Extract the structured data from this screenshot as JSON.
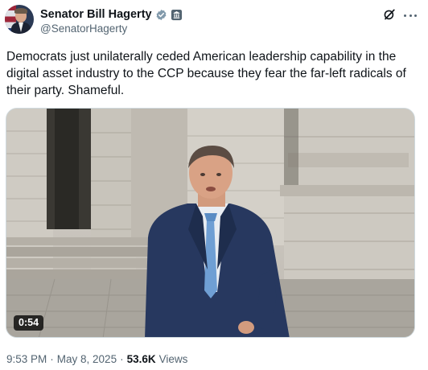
{
  "author": {
    "display_name": "Senator Bill Hagerty",
    "handle": "@SenatorHagerty",
    "verified_badge_color": "#829aab",
    "badge_icon": "verified-badge-icon",
    "affiliation_icon": "government-building-icon"
  },
  "tweet": {
    "text": "Democrats just unilaterally ceded American leadership capability in the digital asset industry to the CCP because they fear the far-left radicals of their party. Shameful."
  },
  "media": {
    "type": "video",
    "duration": "0:54"
  },
  "meta": {
    "time": "9:53 PM",
    "separator": "·",
    "date": "May 8, 2025",
    "views_count": "53.6K",
    "views_label": "Views"
  },
  "icons": {
    "grok": "grok-icon",
    "more": "more-options-icon"
  },
  "colors": {
    "text_primary": "#0f1419",
    "text_secondary": "#536471",
    "border": "#cfd9de"
  }
}
